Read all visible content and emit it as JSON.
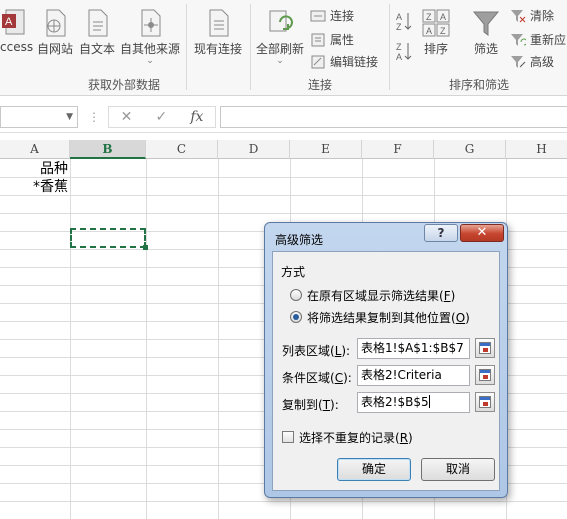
{
  "ribbon": {
    "get_external": {
      "label": "获取外部数据",
      "buttons": [
        "ccess",
        "自网站",
        "自文本",
        "自其他来源",
        "现有连接"
      ]
    },
    "connections": {
      "label": "连接",
      "refresh_all": "全部刷新",
      "items": [
        "连接",
        "属性",
        "编辑链接"
      ]
    },
    "sort_filter": {
      "label": "排序和筛选",
      "sort": "排序",
      "filter": "筛选",
      "items": [
        "清除",
        "重新应",
        "高级"
      ]
    }
  },
  "formula_bar": {
    "name_box": "",
    "cancel": "✕",
    "confirm": "✓",
    "fx": "fx",
    "content": ""
  },
  "grid": {
    "columns": [
      "A",
      "B",
      "C",
      "D",
      "E",
      "F",
      "G",
      "H"
    ],
    "selected_column": "B",
    "cells": {
      "A1": "品种",
      "A2": "*香蕉"
    }
  },
  "dialog": {
    "title": "高级筛选",
    "help": "?",
    "close": "✕",
    "section": "方式",
    "radio1": {
      "text": "在原有区域显示筛选结果(",
      "key": "F",
      "end": ")"
    },
    "radio2": {
      "text": "将筛选结果复制到其他位置(",
      "key": "O",
      "end": ")"
    },
    "list_range": {
      "text": "列表区域(",
      "key": "L",
      "end": "):",
      "value": "表格1!$A$1:$B$7"
    },
    "criteria_range": {
      "text": "条件区域(",
      "key": "C",
      "end": "):",
      "value": "表格2!Criteria"
    },
    "copy_to": {
      "text": "复制到(",
      "key": "T",
      "end": "):",
      "value": "表格2!$B$5"
    },
    "unique": {
      "text": "选择不重复的记录(",
      "key": "R",
      "end": ")"
    },
    "ok": "确定",
    "cancel": "取消"
  },
  "colors": {
    "excel_green": "#217346",
    "dialog_frame": "#aec7e6",
    "close_red": "#c6452f"
  }
}
